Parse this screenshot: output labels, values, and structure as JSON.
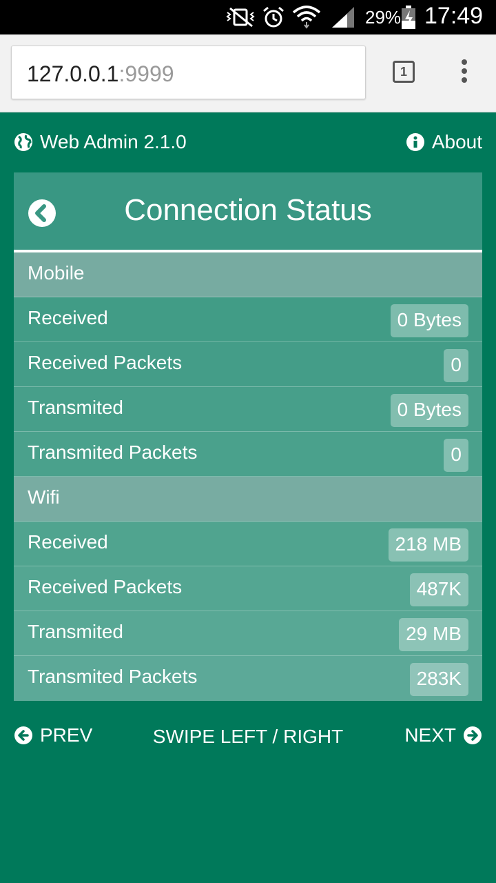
{
  "status_bar": {
    "battery_percent": "29%",
    "time": "17:49",
    "icons": [
      "mute-vibrate-icon",
      "alarm-icon",
      "wifi-icon",
      "signal-icon",
      "battery-charging-icon"
    ]
  },
  "browser": {
    "url_host": "127.0.0.1",
    "url_port": ":9999",
    "tab_count": "1"
  },
  "nav": {
    "brand": "Web Admin 2.1.0",
    "about": "About"
  },
  "panel": {
    "title": "Connection Status",
    "rows": [
      {
        "type": "section",
        "label": "Mobile"
      },
      {
        "type": "item",
        "label": "Received",
        "value": "0 Bytes"
      },
      {
        "type": "item",
        "label": "Received Packets",
        "value": "0"
      },
      {
        "type": "item",
        "label": "Transmited",
        "value": "0 Bytes"
      },
      {
        "type": "item",
        "label": "Transmited Packets",
        "value": "0"
      },
      {
        "type": "section",
        "label": "Wifi"
      },
      {
        "type": "item",
        "label": "Received",
        "value": "218 MB"
      },
      {
        "type": "item",
        "label": "Received Packets",
        "value": "487K"
      },
      {
        "type": "item",
        "label": "Transmited",
        "value": "29 MB"
      },
      {
        "type": "item",
        "label": "Transmited Packets",
        "value": "283K"
      }
    ]
  },
  "footer": {
    "prev": "PREV",
    "hint": "SWIPE LEFT / RIGHT",
    "next": "NEXT"
  },
  "colors": {
    "page_bg": "#00795a",
    "header_bg": "#399783",
    "section_bg": "#77aba1"
  }
}
